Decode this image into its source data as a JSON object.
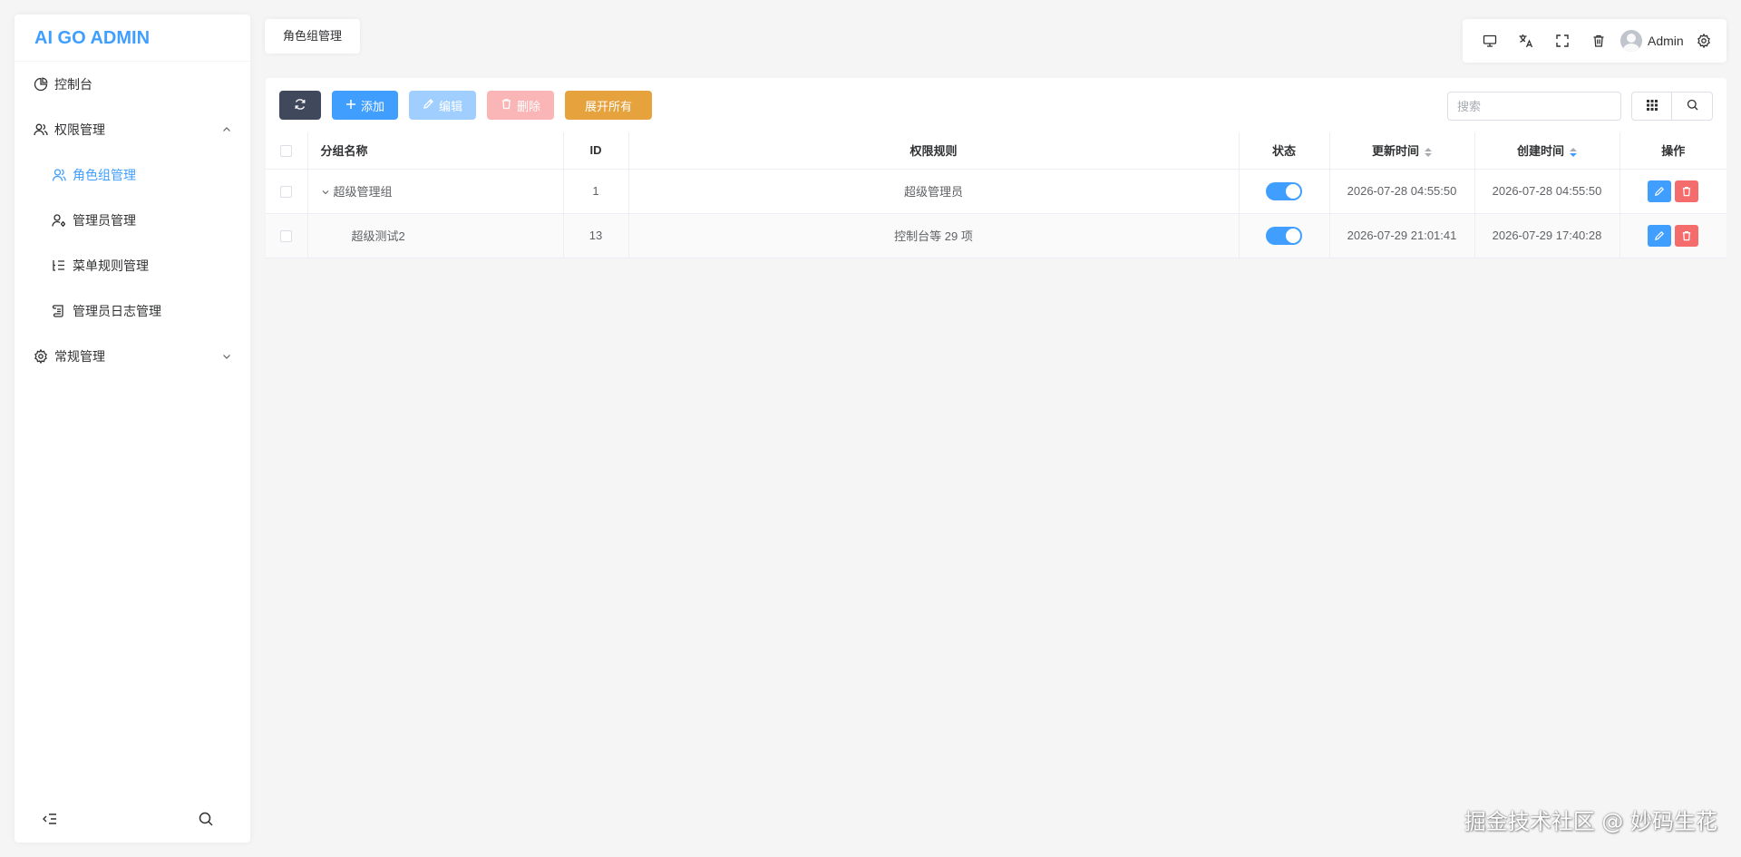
{
  "brand": "AI GO ADMIN",
  "sidebar": {
    "items": [
      {
        "label": "控制台"
      },
      {
        "label": "权限管理"
      },
      {
        "label": "常规管理"
      }
    ],
    "submenu": [
      {
        "label": "角色组管理"
      },
      {
        "label": "管理员管理"
      },
      {
        "label": "菜单规则管理"
      },
      {
        "label": "管理员日志管理"
      }
    ]
  },
  "tab": {
    "label": "角色组管理"
  },
  "topbar": {
    "user": "Admin"
  },
  "toolbar": {
    "add": "添加",
    "edit": "编辑",
    "delete": "删除",
    "expand": "展开所有"
  },
  "search": {
    "placeholder": "搜索"
  },
  "table": {
    "headers": [
      "分组名称",
      "ID",
      "权限规则",
      "状态",
      "更新时间",
      "创建时间",
      "操作"
    ],
    "rows": [
      {
        "name": "超级管理组",
        "id": "1",
        "rules": "超级管理员",
        "updated": "2026-07-28 04:55:50",
        "created": "2026-07-28 04:55:50",
        "enabled": true
      },
      {
        "name": "超级测试2",
        "id": "13",
        "rules": "控制台等 29 项",
        "updated": "2026-07-29 21:01:41",
        "created": "2026-07-29 17:40:28",
        "enabled": true
      }
    ]
  },
  "watermark": "掘金技术社区 @ 妙码生花",
  "colors": {
    "primary": "#409eff",
    "danger": "#f56c6c",
    "warning": "#e6a23c",
    "dark": "#40485b"
  }
}
